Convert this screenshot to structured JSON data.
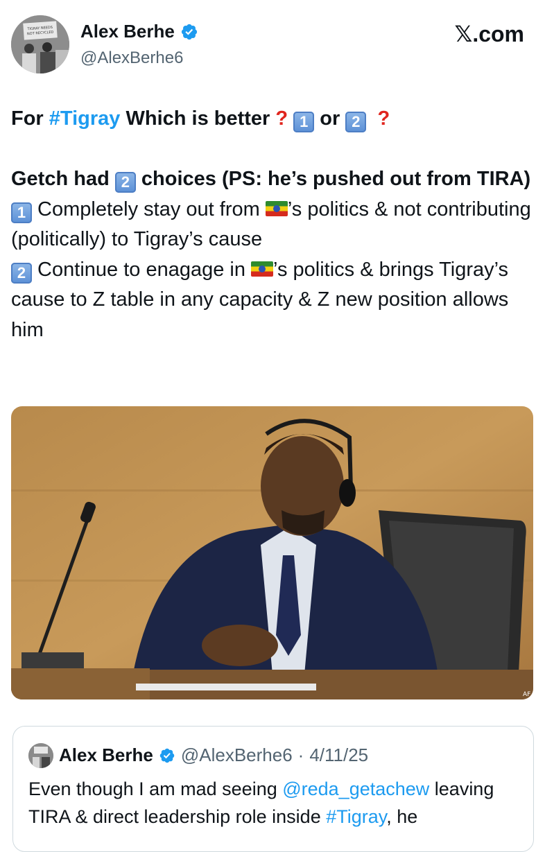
{
  "author": {
    "name": "Alex Berhe",
    "handle": "@AlexBerhe6",
    "verified": true,
    "avatar_sign_text": "TIGRAY NEEDS NOT RECYCLED POLITICS",
    "avatar_icon": "protest-photo-avatar"
  },
  "brand": {
    "label": "𝕏.com"
  },
  "tweet": {
    "line1_prefix": "For ",
    "line1_hashtag": "#Tigray",
    "line1_mid": " Which is better",
    "line1_or": " or ",
    "keycap_1": "1",
    "keycap_2": "2",
    "line2_prefix": "Getch had ",
    "line2_suffix": " choices (PS: he’s pushed out from TIRA)",
    "opt1_a": " Completely stay out from ",
    "opt1_b": "’s politics & not contributing (politically) to Tigray’s cause",
    "opt2_a": " Continue to enagage in ",
    "opt2_b": "’s politics & brings Tigray’s cause to Z table in any capacity & Z new position allows him",
    "flag_icon": "ethiopia-flag-icon",
    "question_mark": "❓"
  },
  "image": {
    "semantic": "man-in-suit-with-headphones-at-conference-table",
    "watermark": "AF"
  },
  "quoted": {
    "name": "Alex Berhe",
    "handle": "@AlexBerhe6",
    "separator": "·",
    "date": "4/11/25",
    "text_a": "Even though I am mad seeing ",
    "mention": "@reda_getachew",
    "text_b": " leaving TIRA & direct leadership role inside ",
    "hashtag": "#Tigray",
    "text_c": ", he"
  },
  "colors": {
    "link": "#1d9bf0",
    "verified": "#1d9bf0",
    "muted": "#536471",
    "text": "#0f1419"
  }
}
